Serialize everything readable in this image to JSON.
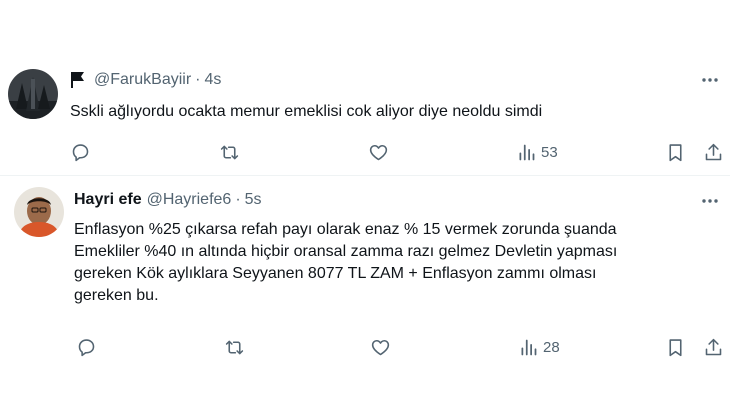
{
  "tweets": [
    {
      "display_name": "",
      "handle": "@FarukBayiir",
      "separator": "·",
      "time": "4s",
      "text": "Sskli ağlıyordu ocakta memur emeklisi cok aliyor diye neoldu simdi",
      "views": "53",
      "icons": {
        "badge": "flag-icon",
        "more": "more-icon",
        "reply": "reply-icon",
        "retweet": "retweet-icon",
        "like": "heart-icon",
        "views": "views-chart-icon",
        "bookmark": "bookmark-icon",
        "share": "share-icon"
      }
    },
    {
      "display_name": "Hayri efe",
      "handle": "@Hayriefe6",
      "separator": "·",
      "time": "5s",
      "text": "Enflasyon %25 çıkarsa refah payı olarak enaz % 15 vermek zorunda şuanda\nEmekliler %40 ın altında hiçbir oransal zamma razı gelmez Devletin yapması\ngereken Kök aylıklara Seyyanen 8077 TL ZAM + Enflasyon zammı olması\ngereken bu.",
      "views": "28",
      "icons": {
        "more": "more-icon",
        "reply": "reply-icon",
        "retweet": "retweet-icon",
        "like": "heart-icon",
        "views": "views-chart-icon",
        "bookmark": "bookmark-icon",
        "share": "share-icon"
      }
    }
  ],
  "colors": {
    "text_primary": "#0f1419",
    "text_secondary": "#536471",
    "divider": "#eff3f4"
  }
}
